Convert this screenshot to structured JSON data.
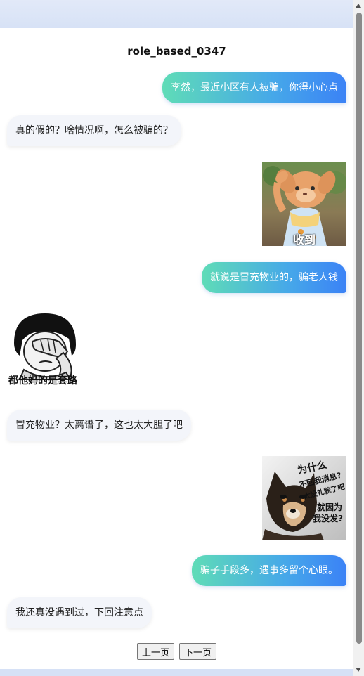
{
  "chat": {
    "title": "role_based_0347",
    "messages": [
      {
        "side": "right",
        "kind": "text",
        "text": "李然，最近小区有人被骗，你得小心点"
      },
      {
        "side": "left",
        "kind": "text",
        "text": "真的假的？啥情况啊，怎么被骗的？"
      },
      {
        "side": "right",
        "kind": "sticker",
        "sticker_text": "收到",
        "icon": "saluting-bear-sticker"
      },
      {
        "side": "right",
        "kind": "text",
        "text": "就说是冒充物业的，骗老人钱"
      },
      {
        "side": "left",
        "kind": "sticker",
        "sticker_text": "都他妈的是套路",
        "icon": "facepalm-meme-sticker"
      },
      {
        "side": "left",
        "kind": "text",
        "text": "冒充物业？太离谱了，这也太大胆了吧"
      },
      {
        "side": "right",
        "kind": "sticker",
        "sticker_lines": [
          "为什么",
          "不回我消息?",
          "太没礼貌了吧",
          "就因为",
          "我没发?"
        ],
        "icon": "shiba-dog-meme-sticker"
      },
      {
        "side": "right",
        "kind": "text",
        "text": "骗子手段多，遇事多留个心眼。"
      },
      {
        "side": "left",
        "kind": "text",
        "text": "我还真没遇到过，下回注意点"
      }
    ]
  },
  "pager": {
    "prev_label": "上一页",
    "next_label": "下一页"
  },
  "colors": {
    "bubble_gradient_start": "#5fdcb7",
    "bubble_gradient_end": "#3b82f6",
    "left_bubble_bg": "#f3f5fa",
    "header_band": "#dce6f7"
  }
}
